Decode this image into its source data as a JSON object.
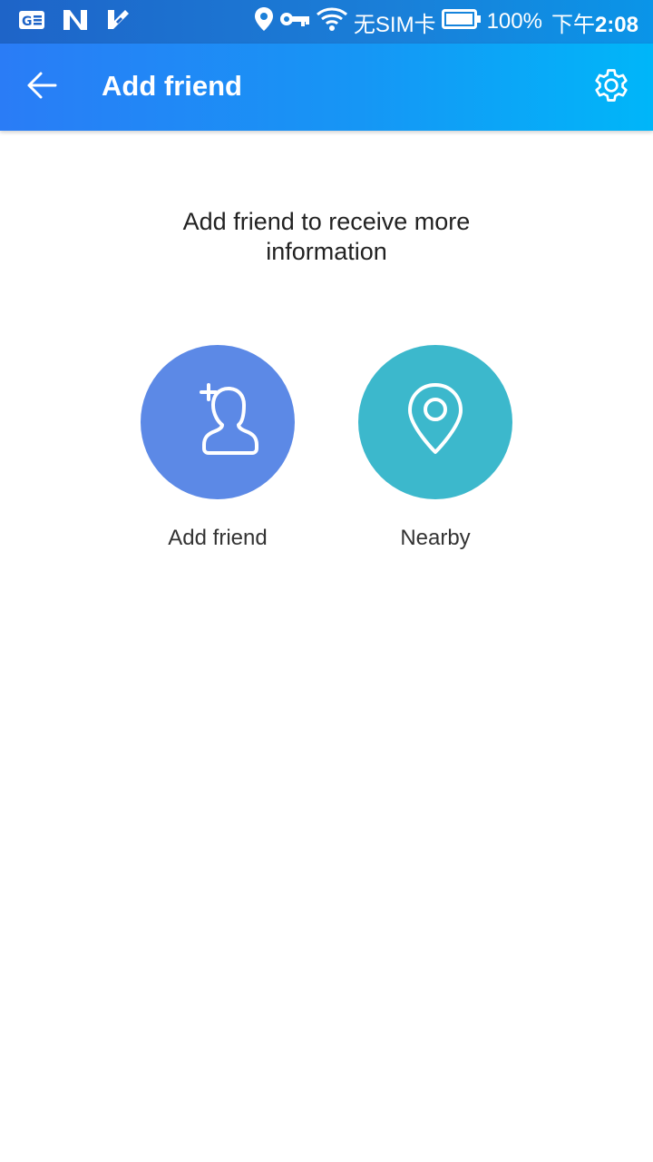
{
  "status_bar": {
    "left_icons": [
      "ge-news-icon",
      "n-app-icon",
      "check-app-icon"
    ],
    "right_icons": [
      "location-icon",
      "vpn-key-icon",
      "wifi-icon",
      "battery-icon"
    ],
    "sim_text": "无SIM卡",
    "battery_text": "100%",
    "time_prefix": "下午",
    "time": "2:08"
  },
  "toolbar": {
    "title": "Add friend",
    "back_icon": "arrow-back-icon",
    "settings_icon": "gear-icon",
    "gradient_start": "#2a7cf6",
    "gradient_end": "#00b6f9"
  },
  "main": {
    "headline": "Add friend to receive more information",
    "actions": [
      {
        "label": "Add friend",
        "icon": "add-person-icon",
        "color": "#5c89e6"
      },
      {
        "label": "Nearby",
        "icon": "location-pin-icon",
        "color": "#3cb8cc"
      }
    ]
  }
}
